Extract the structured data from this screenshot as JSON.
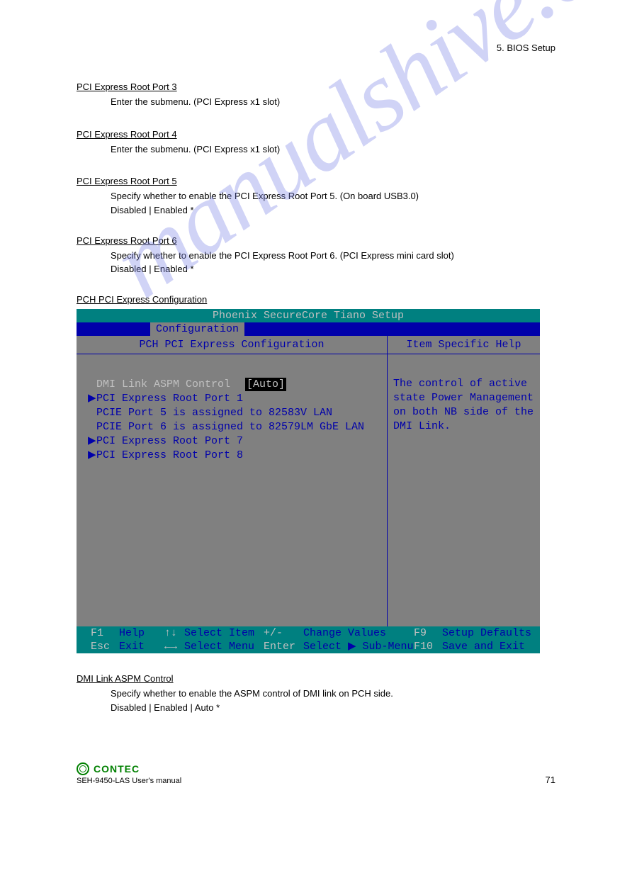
{
  "chapter_label": "5.  BIOS Setup",
  "sections": [
    {
      "heading": "PCI Express Root Port 3",
      "desc": "Enter the submenu.",
      "note": "  (PCI Express x1 slot)"
    },
    {
      "heading": "PCI Express Root Port 4",
      "desc": "Enter the submenu.",
      "note": "  (PCI Express x1 slot)"
    },
    {
      "heading": "PCI Express Root Port 5",
      "desc": "Specify whether to enable the PCI Express Root Port 5.",
      "note": "  (On board USB3.0)",
      "options": "Disabled  |  Enabled *"
    },
    {
      "heading": "PCI Express Root Port 6",
      "desc": "Specify whether to enable the PCI Express Root Port 6.",
      "note": "  (PCI Express mini card slot)",
      "options": "Disabled  |  Enabled *"
    },
    {
      "heading": "PCH PCI Express Configuration",
      "desc": ""
    }
  ],
  "bios": {
    "title": "Phoenix SecureCore Tiano Setup",
    "tab": "Configuration",
    "left_title": "PCH PCI Express Configuration",
    "right_title": "Item Specific Help",
    "rows": [
      {
        "type": "sel",
        "marker": "",
        "label": "DMI Link ASPM Control",
        "value": "[Auto]"
      },
      {
        "type": "sub",
        "marker": "▶",
        "label": "PCI Express Root Port 1",
        "value": ""
      },
      {
        "type": "info",
        "marker": "",
        "label": "PCIE Port 5 is assigned to 82583V LAN",
        "value": ""
      },
      {
        "type": "info",
        "marker": "",
        "label": "PCIE Port 6 is assigned to 82579LM GbE LAN",
        "value": ""
      },
      {
        "type": "sub",
        "marker": "▶",
        "label": "PCI Express Root Port 7",
        "value": ""
      },
      {
        "type": "sub",
        "marker": "▶",
        "label": "PCI Express Root Port 8",
        "value": ""
      }
    ],
    "help": "The control of active state Power Management on both NB side of the DMI Link.",
    "footer": {
      "r1": {
        "k1": "F1",
        "l1": "Help",
        "k2": "↑↓",
        "l2": "Select Item",
        "k3": "+/-",
        "l3": "Change Values",
        "k4": "F9",
        "l4": "Setup Defaults"
      },
      "r2": {
        "k1": "Esc",
        "l1": "Exit",
        "k2": "←→",
        "l2": "Select Menu",
        "k3": "Enter",
        "l3": "Select ▶ Sub-Menu",
        "k4": "F10",
        "l4": "Save and Exit"
      }
    }
  },
  "after_bios": {
    "heading": "DMI Link ASPM Control",
    "desc": "Specify whether to enable the ASPM control of DMI link on PCH side.",
    "options": "Disabled  |  Enabled  |  Auto *"
  },
  "watermark": "manualshive.com",
  "logo_text": "CONTEC",
  "footer_text": "SEH-9450-LAS  User's manual",
  "page_number": "71"
}
